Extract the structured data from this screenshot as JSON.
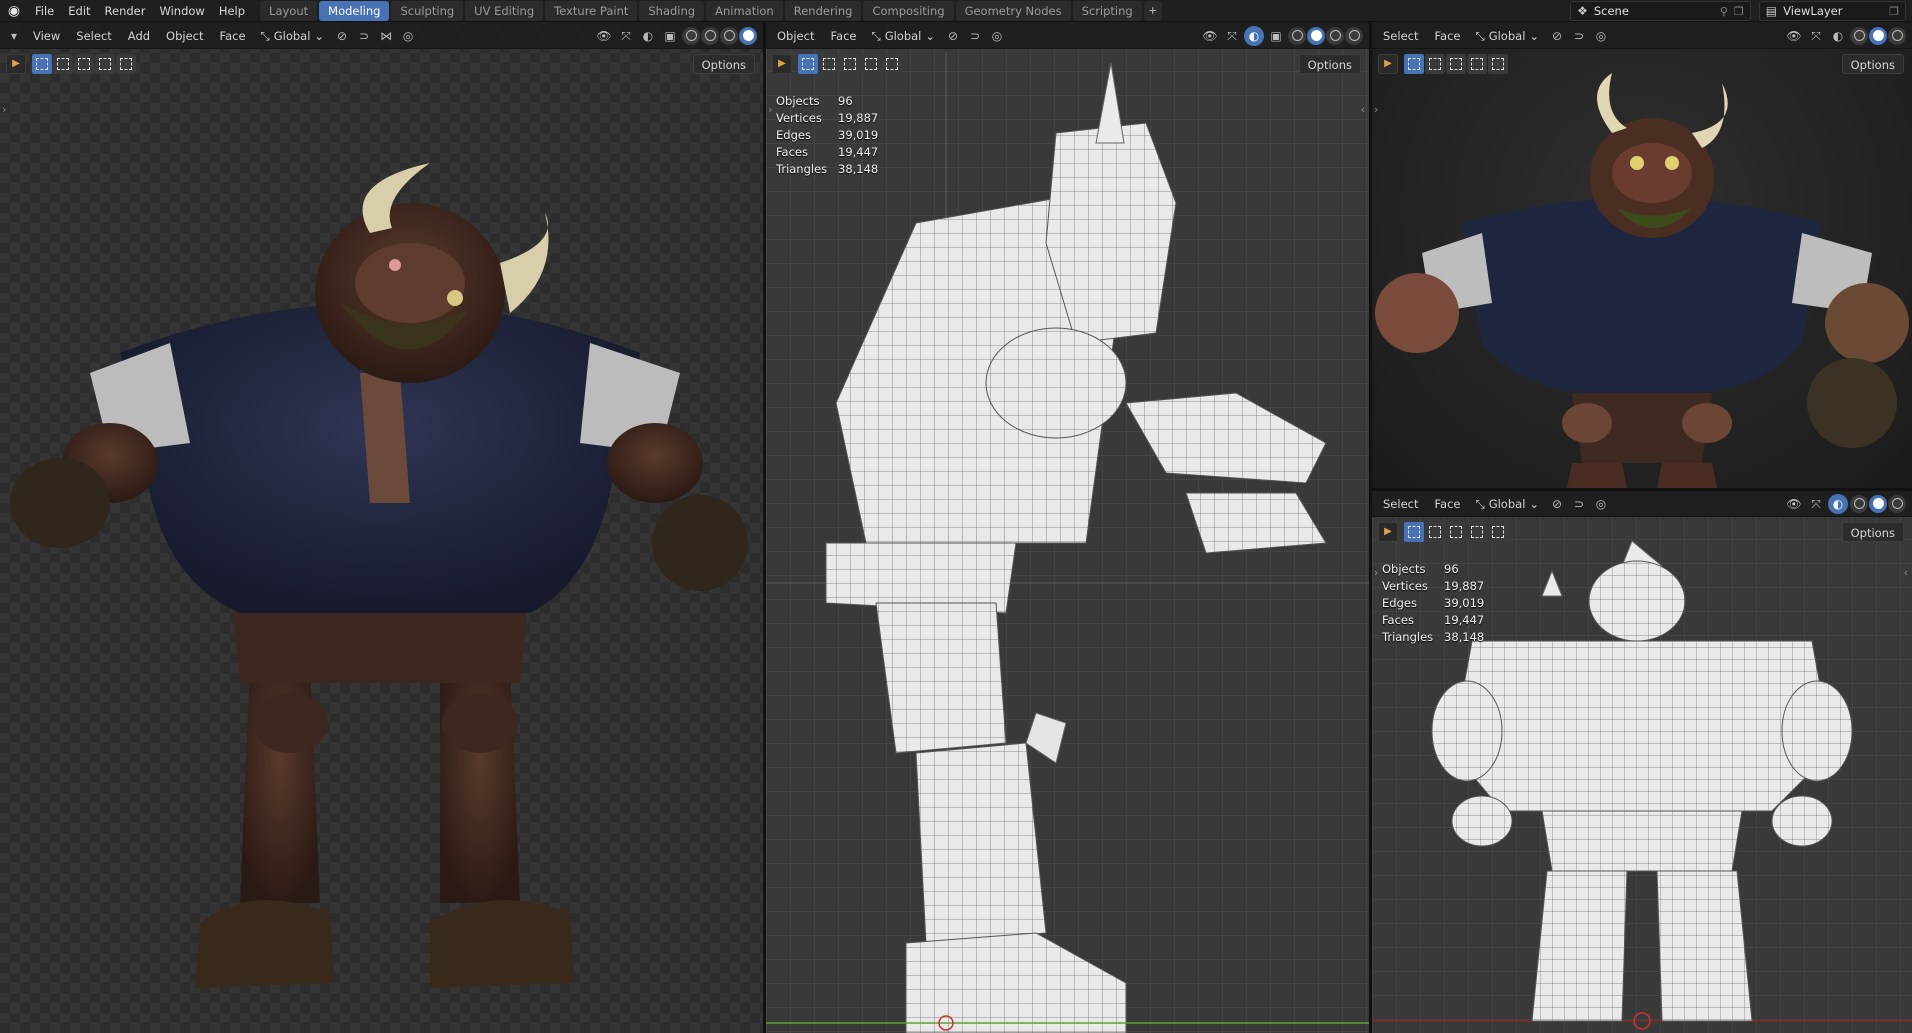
{
  "topbar": {
    "menus": [
      "File",
      "Edit",
      "Render",
      "Window",
      "Help"
    ],
    "workspaces": [
      "Layout",
      "Modeling",
      "Sculpting",
      "UV Editing",
      "Texture Paint",
      "Shading",
      "Animation",
      "Rendering",
      "Compositing",
      "Geometry Nodes",
      "Scripting"
    ],
    "active_workspace": "Modeling",
    "add_tab": "+",
    "scene": "Scene",
    "view_layer": "ViewLayer"
  },
  "left_viewport": {
    "menus": [
      "View",
      "Select",
      "Add",
      "Object",
      "Face"
    ],
    "orientation": "Global",
    "options": "Options"
  },
  "middle_viewport": {
    "menus": [
      "Object",
      "Face"
    ],
    "orientation": "Global",
    "options": "Options",
    "stats": [
      {
        "label": "Objects",
        "value": "96"
      },
      {
        "label": "Vertices",
        "value": "19,887"
      },
      {
        "label": "Edges",
        "value": "39,019"
      },
      {
        "label": "Faces",
        "value": "19,447"
      },
      {
        "label": "Triangles",
        "value": "38,148"
      }
    ]
  },
  "right_top_viewport": {
    "menus": [
      "Select",
      "Face"
    ],
    "orientation": "Global",
    "options": "Options"
  },
  "right_bottom_viewport": {
    "menus": [
      "Select",
      "Face"
    ],
    "orientation": "Global",
    "options": "Options",
    "stats": [
      {
        "label": "Objects",
        "value": "96"
      },
      {
        "label": "Vertices",
        "value": "19,887"
      },
      {
        "label": "Edges",
        "value": "39,019"
      },
      {
        "label": "Faces",
        "value": "19,447"
      },
      {
        "label": "Triangles",
        "value": "38,148"
      }
    ]
  },
  "colors": {
    "accent": "#4772b3",
    "header": "#1f1f1f",
    "viewport_grid": "#393939"
  }
}
